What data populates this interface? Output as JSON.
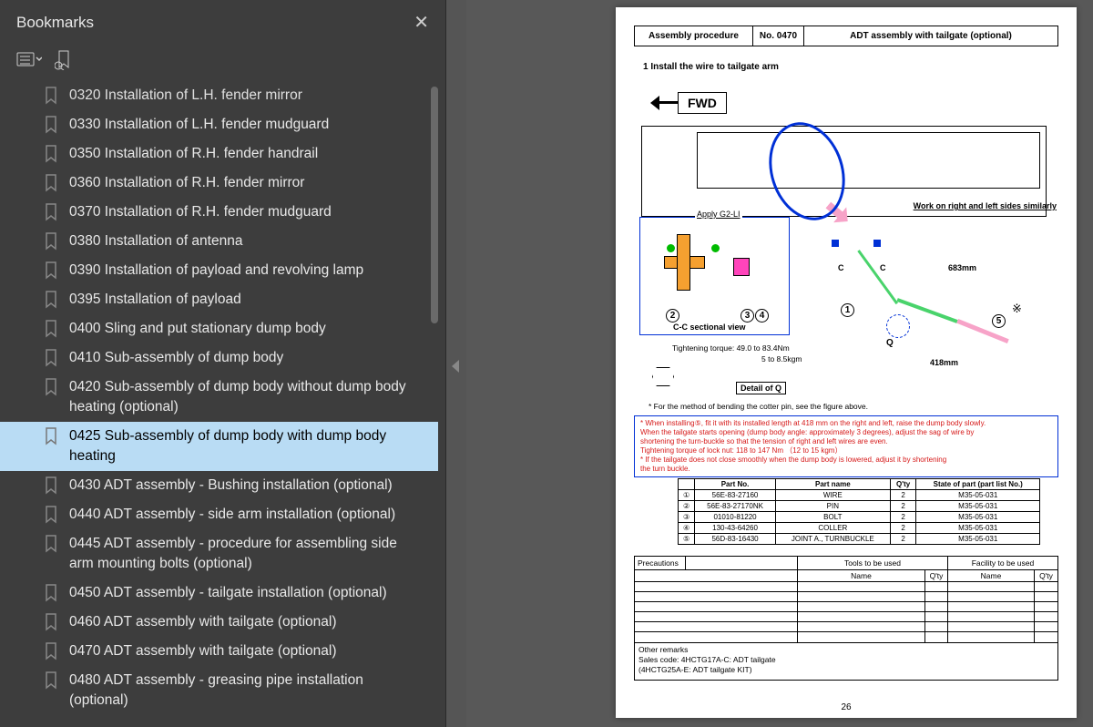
{
  "sidebar": {
    "title": "Bookmarks",
    "items": [
      "0320 Installation of L.H. fender mirror",
      "0330 Installation of L.H. fender mudguard",
      "0350 Installation of R.H. fender handrail",
      "0360 Installation of R.H. fender mirror",
      "0370 Installation of R.H. fender mudguard",
      "0380 Installation of antenna",
      "0390 Installation of payload and revolving lamp",
      "0395 Installation of payload",
      "0400 Sling and put stationary dump body",
      "0410 Sub-assembly of dump body",
      "0420 Sub-assembly of dump body without dump body heating (optional)",
      "0425 Sub-assembly of dump body with dump body heating",
      "0430 ADT assembly - Bushing installation (optional)",
      "0440 ADT assembly - side arm installation (optional)",
      "0445 ADT assembly - procedure for assembling side arm mounting bolts (optional)",
      "0450 ADT assembly - tailgate installation (optional)",
      "0460 ADT assembly with tailgate (optional)",
      "0470 ADT assembly with tailgate (optional)",
      "0480 ADT assembly - greasing pipe  installation (optional)"
    ],
    "selected_index": 11
  },
  "doc": {
    "header": {
      "col1": "Assembly procedure",
      "col2": "No. 0470",
      "col3": "ADT assembly with tailgate (optional)"
    },
    "step1": "1   Install the wire to tailgate arm",
    "fwd": "FWD",
    "apply": "Apply G2-LI",
    "cc_view": "C-C sectional view",
    "work_note": "Work on right and left sides similarly",
    "torque1": "Tightening torque: 49.0 to 83.4Nm",
    "torque2": "5 to 8.5kgm",
    "detail_q": "Detail of Q",
    "mm683": "683mm",
    "mm418": "418mm",
    "c_label": "C",
    "q_label": "Q",
    "asterisk_sym": "※",
    "method_note": "* For the method of bending the cotter pin, see the figure above.",
    "red_note_lines": [
      "* When installing⑤, fit it with its installed length at 418 mm on the right and left, raise the dump body slowly.",
      "  When the tailgate starts opening (dump body angle: approximately 3 degrees), adjust the sag of wire by",
      "  shortening the turn-buckle so that the tension of right and left wires are even.",
      "  Tightening torque of lock nut: 118 to 147 Nm （12 to 15 kgm）",
      "* If the tailgate does not close smoothly when the dump body is lowered, adjust it by shortening",
      "  the turn buckle."
    ],
    "parts_headers": [
      "",
      "Part No.",
      "Part name",
      "Q'ty",
      "State of part (part list No.)"
    ],
    "parts_rows": [
      [
        "①",
        "56E-83-27160",
        "WIRE",
        "2",
        "M35-05-031"
      ],
      [
        "②",
        "56E-83-27170NK",
        "PIN",
        "2",
        "M35-05-031"
      ],
      [
        "③",
        "01010-81220",
        "BOLT",
        "2",
        "M35-05-031"
      ],
      [
        "④",
        "130-43-64260",
        "COLLER",
        "2",
        "M35-05-031"
      ],
      [
        "⑤",
        "56D-83-16430",
        "JOINT A., TURNBUCKLE",
        "2",
        "M35-05-031"
      ]
    ],
    "bottom": {
      "precautions": "Precautions",
      "tools": "Tools to be used",
      "facility": "Facility to be used",
      "name": "Name",
      "qty": "Q'ty",
      "remarks_title": "Other remarks",
      "remarks_l1": "Sales code: 4HCTG17A-C: ADT tailgate",
      "remarks_l2": "(4HCTG25A-E: ADT tailgate KIT)"
    },
    "page_num": "26"
  }
}
